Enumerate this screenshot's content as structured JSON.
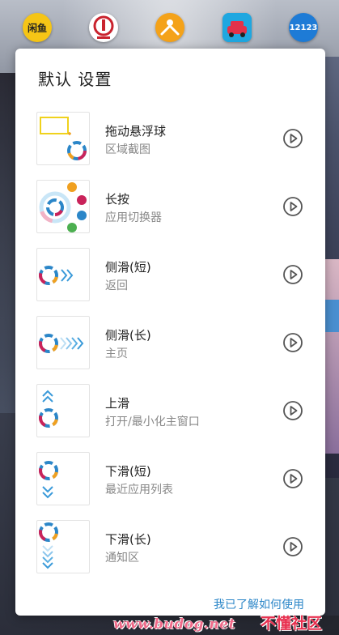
{
  "top_apps": [
    {
      "name": "闲鱼",
      "color": "#f6c516",
      "text_color": "#222222"
    },
    {
      "name": "铁路12306",
      "color": "#ffffff",
      "text_color": "#c9232e"
    },
    {
      "name": "app-orange",
      "color": "#f4a219",
      "text_color": "#ffffff"
    },
    {
      "name": "app-car",
      "color": "#1fa7e0",
      "text_color": "#ffffff"
    },
    {
      "name": "12123",
      "color": "#1e7bd6",
      "text_color": "#ffffff"
    }
  ],
  "dialog": {
    "title": "默认 设置",
    "items": [
      {
        "title": "拖动悬浮球",
        "subtitle": "区域截图"
      },
      {
        "title": "长按",
        "subtitle": "应用切换器"
      },
      {
        "title": "侧滑(短)",
        "subtitle": "返回"
      },
      {
        "title": "侧滑(长)",
        "subtitle": "主页"
      },
      {
        "title": "上滑",
        "subtitle": "打开/最小化主窗口"
      },
      {
        "title": "下滑(短)",
        "subtitle": "最近应用列表"
      },
      {
        "title": "下滑(长)",
        "subtitle": "通知区"
      }
    ],
    "footer_link": "我已了解如何使用"
  },
  "watermark": {
    "site": "www.budog.net",
    "brand": "不懂社区"
  },
  "colors": {
    "accent": "#2b86c8",
    "chevron": "#3a9ad9",
    "ball_red": "#c9235a",
    "ball_orange": "#f0a020",
    "ball_green": "#4caf50",
    "ball_blue": "#2b86c8"
  }
}
